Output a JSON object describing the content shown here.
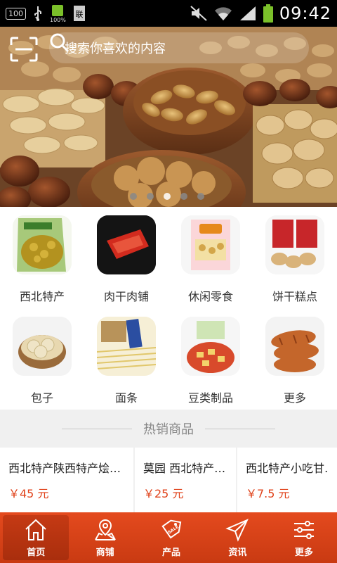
{
  "status_bar": {
    "time": "09:42",
    "battery_percent_label": "100%",
    "left_box_label": "100"
  },
  "search": {
    "placeholder": "搜索你喜欢的内容"
  },
  "banner": {
    "carousel_pages": 5,
    "active_page": 3
  },
  "categories": [
    {
      "label": "西北特产"
    },
    {
      "label": "肉干肉铺"
    },
    {
      "label": "休闲零食"
    },
    {
      "label": "饼干糕点"
    },
    {
      "label": "包子"
    },
    {
      "label": "面条"
    },
    {
      "label": "豆类制品"
    },
    {
      "label": "更多"
    }
  ],
  "hot_section": {
    "title": "热销商品"
  },
  "products": [
    {
      "name": "西北特产陕西特产烩…",
      "price": "￥45 元"
    },
    {
      "name": "莫园 西北特产…",
      "price": "￥25 元"
    },
    {
      "name": "西北特产小吃甘…",
      "price": "￥7.5 元"
    }
  ],
  "tabs": [
    {
      "label": "首页",
      "icon": "home-icon"
    },
    {
      "label": "商铺",
      "icon": "map-pin-icon"
    },
    {
      "label": "产品",
      "icon": "sale-tag-icon"
    },
    {
      "label": "资讯",
      "icon": "send-icon"
    },
    {
      "label": "更多",
      "icon": "sliders-icon"
    }
  ],
  "colors": {
    "accent": "#e0421a",
    "tabbar": "#d9431a"
  }
}
